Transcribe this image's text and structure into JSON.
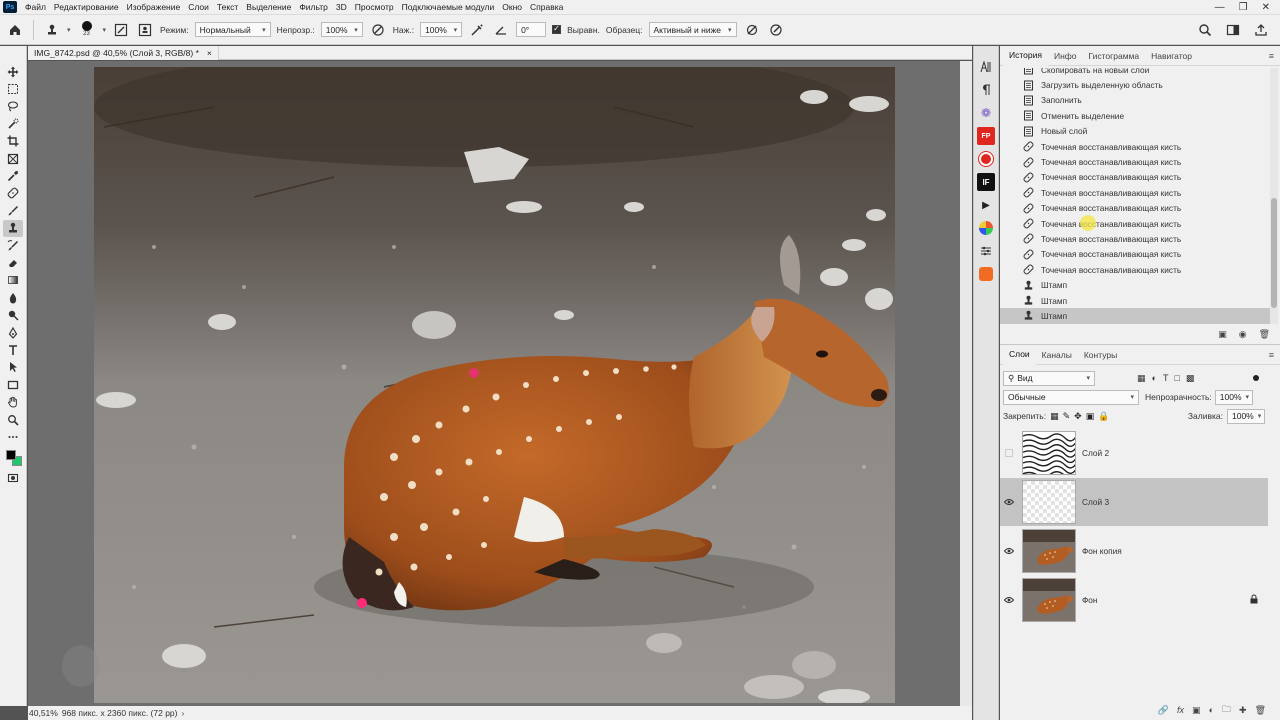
{
  "app": {
    "logo_text": "Ps"
  },
  "menu": [
    "Файл",
    "Редактирование",
    "Изображение",
    "Слои",
    "Текст",
    "Выделение",
    "Фильтр",
    "3D",
    "Просмотр",
    "Подключаемые модули",
    "Окно",
    "Справка"
  ],
  "options_bar": {
    "brush_size": "23",
    "mode_label": "Режим:",
    "mode_value": "Нормальный",
    "opacity_label": "Непрозр.:",
    "opacity_value": "100%",
    "pressure_label": "Наж.:",
    "pressure_value": "100%",
    "angle_value": "0°",
    "aligned_label": "Выравн.",
    "sample_label": "Образец:",
    "sample_value": "Активный и ниже"
  },
  "document": {
    "tab_title": "IMG_8742.psd @ 40,5% (Слой 3, RGB/8) *",
    "close_glyph": "×"
  },
  "status_bar": {
    "zoom": "40,51%",
    "info": "968 пикс. x 2360 пикс. (72 pp)"
  },
  "history_panel": {
    "tabs": [
      "История",
      "Инфо",
      "Гистограмма",
      "Навигатор"
    ],
    "items": [
      {
        "label": "Скопировать на новый слой",
        "icon": "doc-icon"
      },
      {
        "label": "Загрузить выделенную область",
        "icon": "doc-icon"
      },
      {
        "label": "Заполнить",
        "icon": "doc-icon"
      },
      {
        "label": "Отменить выделение",
        "icon": "doc-icon"
      },
      {
        "label": "Новый слой",
        "icon": "doc-icon"
      },
      {
        "label": "Точечная восстанавливающая кисть",
        "icon": "healing-brush-icon"
      },
      {
        "label": "Точечная восстанавливающая кисть",
        "icon": "healing-brush-icon"
      },
      {
        "label": "Точечная восстанавливающая кисть",
        "icon": "healing-brush-icon"
      },
      {
        "label": "Точечная восстанавливающая кисть",
        "icon": "healing-brush-icon"
      },
      {
        "label": "Точечная восстанавливающая кисть",
        "icon": "healing-brush-icon"
      },
      {
        "label": "Точечная восстанавливающая кисть",
        "icon": "healing-brush-icon"
      },
      {
        "label": "Точечная восстанавливающая кисть",
        "icon": "healing-brush-icon"
      },
      {
        "label": "Точечная восстанавливающая кисть",
        "icon": "healing-brush-icon"
      },
      {
        "label": "Точечная восстанавливающая кисть",
        "icon": "healing-brush-icon"
      },
      {
        "label": "Штамп",
        "icon": "stamp-icon"
      },
      {
        "label": "Штамп",
        "icon": "stamp-icon"
      },
      {
        "label": "Штамп",
        "icon": "stamp-icon",
        "selected": true
      }
    ]
  },
  "layers_panel": {
    "tabs": [
      "Слои",
      "Каналы",
      "Контуры"
    ],
    "filter_kind": "Вид",
    "blend_mode": "Обычные",
    "opacity_label": "Непрозрачность:",
    "opacity_value": "100%",
    "lock_label": "Закрепить:",
    "fill_label": "Заливка:",
    "fill_value": "100%",
    "layers": [
      {
        "name": "Слой 2",
        "visible": false,
        "selected": false,
        "thumb": "pattern",
        "locked": false
      },
      {
        "name": "Слой 3",
        "visible": true,
        "selected": true,
        "thumb": "transparent",
        "locked": false
      },
      {
        "name": "Фон копия",
        "visible": true,
        "selected": false,
        "thumb": "photo",
        "locked": false
      },
      {
        "name": "Фон",
        "visible": true,
        "selected": false,
        "thumb": "photo",
        "locked": true
      }
    ]
  },
  "colors": {
    "foreground": "#000000",
    "background": "#1ec86e",
    "canvas_bg": "#6e6e6e",
    "panel_bg": "#f0f0f0",
    "selection": "#c3c3c3",
    "cursor_highlight": "#f5e642"
  },
  "icons": {
    "toolbar": [
      "move-tool-icon",
      "marquee-tool-icon",
      "lasso-tool-icon",
      "quick-select-tool-icon",
      "crop-tool-icon",
      "frame-tool-icon",
      "eyedropper-tool-icon",
      "healing-brush-tool-icon",
      "brush-tool-icon",
      "clone-stamp-tool-icon",
      "history-brush-tool-icon",
      "eraser-tool-icon",
      "gradient-tool-icon",
      "blur-tool-icon",
      "dodge-tool-icon",
      "pen-tool-icon",
      "type-tool-icon",
      "path-select-tool-icon",
      "rectangle-tool-icon",
      "hand-tool-icon",
      "zoom-tool-icon",
      "more-tools-icon"
    ]
  }
}
